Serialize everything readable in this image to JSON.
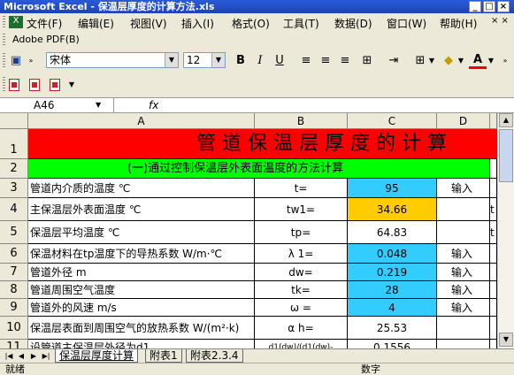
{
  "window": {
    "title": "Microsoft Excel - 保温层厚度的计算方法.xls",
    "controls": [
      "_",
      "□",
      "×"
    ]
  },
  "menu": [
    "文件(F)",
    "编辑(E)",
    "视图(V)",
    "插入(I)",
    "格式(O)",
    "工具(T)",
    "数据(D)",
    "窗口(W)",
    "帮助(H)"
  ],
  "toolbar_pdf": {
    "label": "Adobe PDF(B)"
  },
  "format_toolbar": {
    "font_name": "宋体",
    "font_size": "12",
    "bold": "B",
    "italic": "I",
    "underline": "U",
    "font_color_label": "A"
  },
  "formula_bar": {
    "name_box": "A46",
    "fx": "fx",
    "content": ""
  },
  "columns": [
    "A",
    "B",
    "C",
    "D"
  ],
  "rows": [
    {
      "num": "1",
      "title": "管 道 保 温 层 厚 度 的 计 算"
    },
    {
      "num": "2",
      "subtitle": "(一)通过控制保温层外表面温度的方法计算"
    },
    {
      "num": "3",
      "a": "管道内介质的温度    ℃",
      "b": "t=",
      "c": "95",
      "d": "输入"
    },
    {
      "num": "4",
      "a": "主保温层外表面温度    ℃",
      "b": "tw1=",
      "c": "34.66",
      "d": "",
      "e": "t"
    },
    {
      "num": "5",
      "a": "保温层平均温度      ℃",
      "b": "tp=",
      "c": "64.83",
      "d": "",
      "e": "t"
    },
    {
      "num": "6",
      "a": "保温材料在tp温度下的导热系数 W/m·℃",
      "b": "λ 1=",
      "c": "0.048",
      "d": "输入"
    },
    {
      "num": "7",
      "a": "管道外径   m",
      "b": "dw=",
      "c": "0.219",
      "d": "输入"
    },
    {
      "num": "8",
      "a": "管道周围空气温度",
      "b": "tk=",
      "c": "28",
      "d": "输入"
    },
    {
      "num": "9",
      "a": "管道外的风速   m/s",
      "b": "ω =",
      "c": "4",
      "d": "输入"
    },
    {
      "num": "10",
      "a": "保温层表面到周围空气的放热系数 W/(m²·k)",
      "b": "α h=",
      "c": "25.53"
    },
    {
      "num": "11",
      "a": "设管道主保温层外径为d1",
      "b": "d1(dw)/(d1(dw)-",
      "c": "0.1556"
    }
  ],
  "sheets": [
    "保温层厚度计算",
    "附表1",
    "附表2.3.4"
  ],
  "status": {
    "left": "就绪",
    "right": "数字"
  },
  "colors": {
    "title_row": "#ff0000",
    "subtitle_row": "#00ff00",
    "input_cell": "#33ccff",
    "result_cell": "#ffcc00"
  }
}
